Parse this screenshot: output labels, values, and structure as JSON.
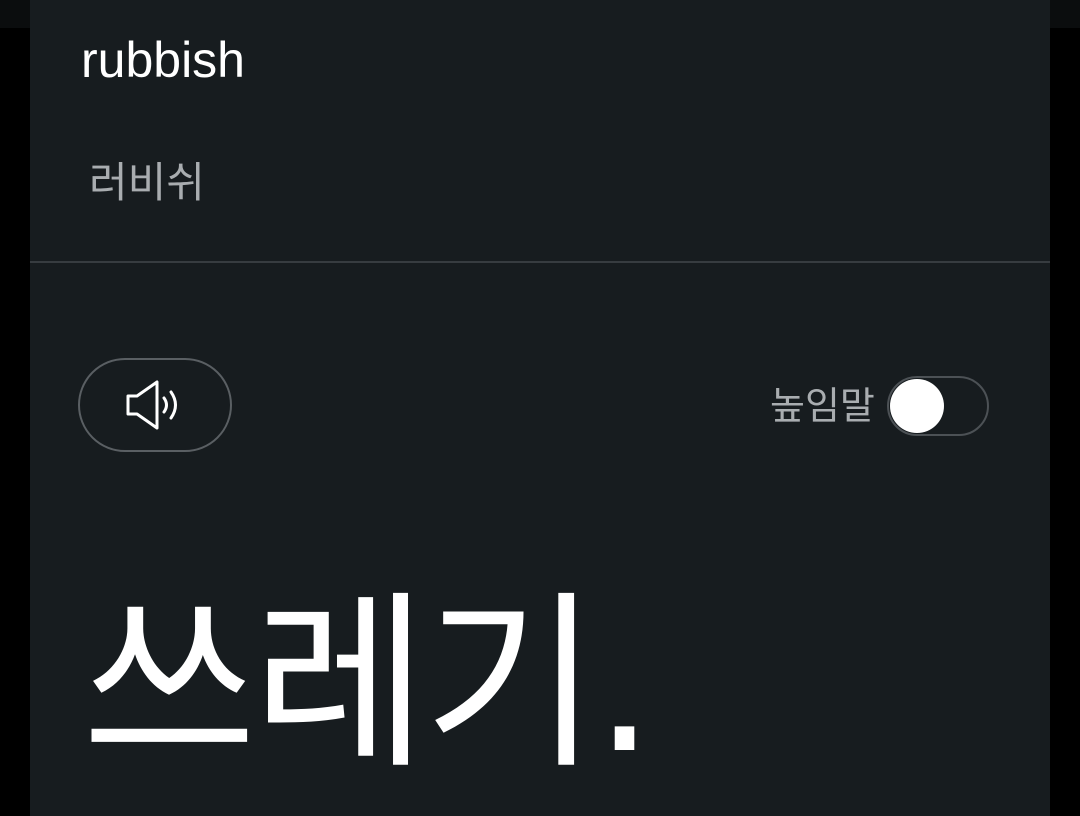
{
  "entry": {
    "source_word": "rubbish",
    "pronunciation": "러비쉬",
    "translation": "쓰레기."
  },
  "controls": {
    "speak_icon": "speaker-sound-icon",
    "honorific_label": "높임말",
    "honorific_enabled": false
  },
  "colors": {
    "background": "#000000",
    "card": "#171c1f",
    "primary_text": "#ffffff",
    "secondary_text": "#a9adb0",
    "divider": "#373c40"
  }
}
